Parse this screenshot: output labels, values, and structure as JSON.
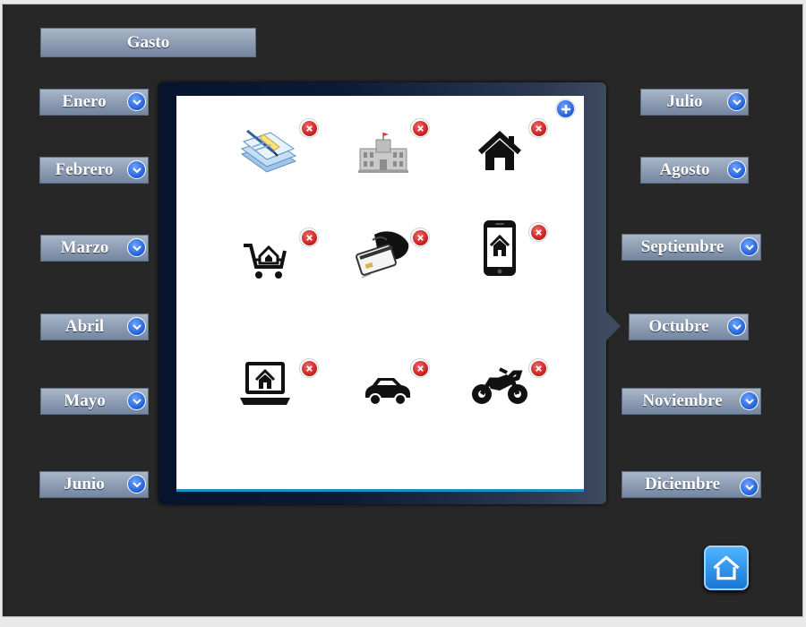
{
  "header": {
    "title": "Gasto"
  },
  "months_left": [
    {
      "label": "Enero"
    },
    {
      "label": "Febrero"
    },
    {
      "label": "Marzo"
    },
    {
      "label": "Abril"
    },
    {
      "label": "Mayo"
    },
    {
      "label": "Junio"
    }
  ],
  "months_right": [
    {
      "label": "Julio"
    },
    {
      "label": "Agosto"
    },
    {
      "label": "Septiembre"
    },
    {
      "label": "Octubre"
    },
    {
      "label": "Noviembre"
    },
    {
      "label": "Diciembre"
    }
  ],
  "popup": {
    "categories": [
      {
        "icon": "documents-icon"
      },
      {
        "icon": "government-building-icon"
      },
      {
        "icon": "house-icon"
      },
      {
        "icon": "shopping-cart-home-icon"
      },
      {
        "icon": "credit-card-hand-icon"
      },
      {
        "icon": "phone-home-icon"
      },
      {
        "icon": "laptop-home-icon"
      },
      {
        "icon": "car-icon"
      },
      {
        "icon": "motorcycle-icon"
      }
    ]
  },
  "colors": {
    "background": "#272727",
    "button_top": "#a9b6c8",
    "button_bottom": "#7385a0",
    "accent_blue": "#1f5fd6",
    "delete_red": "#c01515"
  }
}
